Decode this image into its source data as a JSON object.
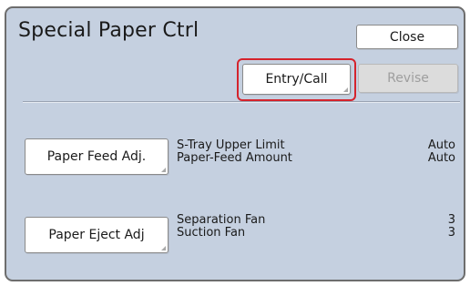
{
  "header": {
    "title": "Special Paper Ctrl",
    "close_label": "Close"
  },
  "toolbar": {
    "entry_call_label": "Entry/Call",
    "revise_label": "Revise"
  },
  "paper_feed": {
    "button_label": "Paper Feed Adj.",
    "settings": [
      {
        "label": "S-Tray Upper Limit",
        "value": "Auto"
      },
      {
        "label": "Paper-Feed Amount",
        "value": "Auto"
      }
    ]
  },
  "paper_eject": {
    "button_label": "Paper Eject Adj",
    "settings": [
      {
        "label": "Separation Fan",
        "value": "3"
      },
      {
        "label": "Suction Fan",
        "value": "3"
      }
    ]
  },
  "colors": {
    "panel_background": "#c5d0e0",
    "highlight_border": "#d5232c",
    "disabled_button": "#dcdcdc"
  }
}
